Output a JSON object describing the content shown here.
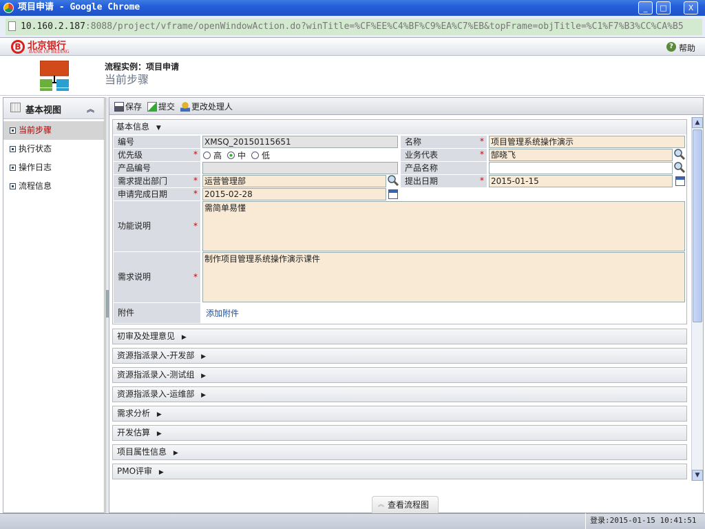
{
  "window": {
    "title": "项目申请 - Google Chrome",
    "min": "_",
    "max": "□",
    "close": "X"
  },
  "address": {
    "host": "10.160.2.187",
    "rest": ":8088/project/vframe/openWindowAction.do?winTitle=%CF%EE%C4%BF%C9%EA%C7%EB&topFrame=objTitle=%C1%F7%B3%CC%CA%B5"
  },
  "brand": {
    "cn": "北京银行",
    "en": "BANK OF BEIJING"
  },
  "help": "帮助",
  "header": {
    "breadcrumb": "流程实例：项目申请",
    "title": "当前步骤"
  },
  "sidebar": {
    "title": "基本视图",
    "items": [
      {
        "label": "当前步骤",
        "active": true
      },
      {
        "label": "执行状态"
      },
      {
        "label": "操作日志"
      },
      {
        "label": "流程信息"
      }
    ]
  },
  "toolbar": {
    "save": "保存",
    "submit": "提交",
    "change_handler": "更改处理人"
  },
  "basic": {
    "title": "基本信息",
    "id_label": "编号",
    "id_value": "XMSQ_20150115651",
    "name_label": "名称",
    "name_value": "项目管理系统操作演示",
    "priority_label": "优先级",
    "priority_options": [
      "高",
      "中",
      "低"
    ],
    "priority_selected": "中",
    "biz_rep_label": "业务代表",
    "biz_rep_value": "郜晓飞",
    "product_no_label": "产品编号",
    "product_no_value": "",
    "product_name_label": "产品名称",
    "product_name_value": "",
    "dept_label": "需求提出部门",
    "dept_value": "运营管理部",
    "submit_date_label": "提出日期",
    "submit_date_value": "2015-01-15",
    "finish_date_label": "申请完成日期",
    "finish_date_value": "2015-02-28",
    "func_label": "功能说明",
    "func_value": "需简单易懂",
    "req_label": "需求说明",
    "req_value": "制作项目管理系统操作演示课件",
    "attach_label": "附件",
    "attach_link": "添加附件"
  },
  "sections": [
    "初审及处理意见",
    "资源指派录入-开发部",
    "资源指派录入-测试组",
    "资源指派录入-运维部",
    "需求分析",
    "开发估算",
    "项目属性信息",
    "PMO评审"
  ],
  "flow_tab": "查看流程图",
  "status": {
    "login": "登录:2015-01-15 10:41:51"
  },
  "colors": {
    "required_field": "#f9ead6",
    "label_bg": "#d9dce3",
    "titlebar": "#245edb",
    "brand": "#d9201d"
  }
}
